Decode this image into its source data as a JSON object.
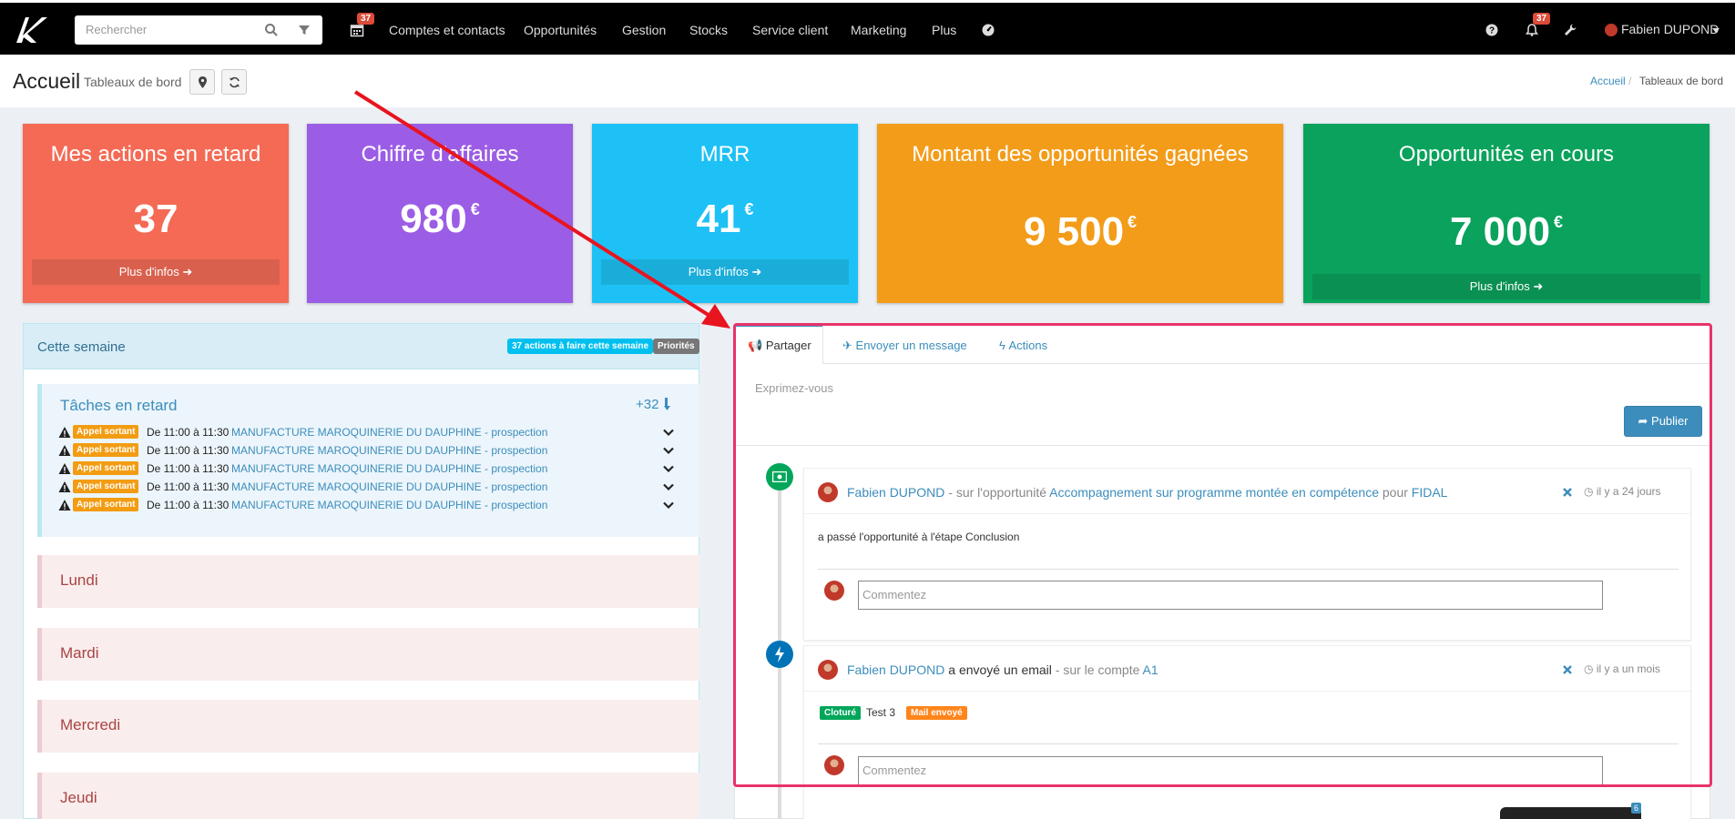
{
  "topbar": {
    "search_placeholder": "Rechercher",
    "calendar_badge": "37",
    "nav_items": [
      "Comptes et contacts",
      "Opportunités",
      "Gestion",
      "Stocks",
      "Service client",
      "Marketing",
      "Plus"
    ],
    "notif_badge": "37",
    "user": "Fabien DUPOND"
  },
  "header": {
    "title": "Accueil",
    "subtitle": "Tableaux de bord",
    "breadcrumb_home": "Accueil",
    "breadcrumb_sep": "/",
    "breadcrumb_current": "Tableaux de bord"
  },
  "cards": [
    {
      "title": "Mes actions en retard",
      "value": "37",
      "unit": "",
      "more": "Plus d'infos",
      "color": "#f46a55"
    },
    {
      "title": "Chiffre d'affaires",
      "value": "980",
      "unit": "€",
      "more": "",
      "color": "#9b5de5"
    },
    {
      "title": "MRR",
      "value": "41",
      "unit": "€",
      "more": "Plus d'infos",
      "color": "#1ec1f5"
    },
    {
      "title": "Montant des opportunités gagnées",
      "value": "9 500",
      "unit": "€",
      "more": "",
      "color": "#f39c19"
    },
    {
      "title": "Opportunités en cours",
      "value": "7 000",
      "unit": "€",
      "more": "Plus d'infos",
      "color": "#0aa25c"
    }
  ],
  "week": {
    "title": "Cette semaine",
    "badge_actions": "37 actions à faire cette semaine",
    "badge_priorities": "Priorités",
    "late_title": "Tâches en retard",
    "late_count": "+32",
    "tasks": [
      {
        "tag": "Appel sortant",
        "time": "De 11:00 à 11:30",
        "link": "MANUFACTURE MAROQUINERIE DU DAUPHINE - prospection"
      },
      {
        "tag": "Appel sortant",
        "time": "De 11:00 à 11:30",
        "link": "MANUFACTURE MAROQUINERIE DU DAUPHINE - prospection"
      },
      {
        "tag": "Appel sortant",
        "time": "De 11:00 à 11:30",
        "link": "MANUFACTURE MAROQUINERIE DU DAUPHINE - prospection"
      },
      {
        "tag": "Appel sortant",
        "time": "De 11:00 à 11:30",
        "link": "MANUFACTURE MAROQUINERIE DU DAUPHINE - prospection"
      },
      {
        "tag": "Appel sortant",
        "time": "De 11:00 à 11:30",
        "link": "MANUFACTURE MAROQUINERIE DU DAUPHINE - prospection"
      }
    ],
    "days": [
      "Lundi",
      "Mardi",
      "Mercredi",
      "Jeudi"
    ]
  },
  "activity": {
    "tabs": [
      "Partager",
      "Envoyer un message",
      "Actions"
    ],
    "placeholder": "Exprimez-vous",
    "publish": "Publier",
    "items": [
      {
        "author": "Fabien DUPOND",
        "pre": "- sur l'opportunité",
        "link": "Accompagnement sur programme montée en compétence",
        "mid": "pour",
        "target": "FIDAL",
        "ago": "il y a 24 jours",
        "body": "a passé l'opportunité à l'étape Conclusion",
        "comment": "Commentez"
      },
      {
        "author": "Fabien DUPOND",
        "pre": "a envoyé un email",
        "mid": "- sur le compte",
        "target": "A1",
        "ago": "il y a un mois",
        "label_closed": "Cloturé",
        "subject": "Test 3",
        "label_mail": "Mail envoyé",
        "comment": "Commentez"
      }
    ]
  },
  "chat_badge": "6"
}
